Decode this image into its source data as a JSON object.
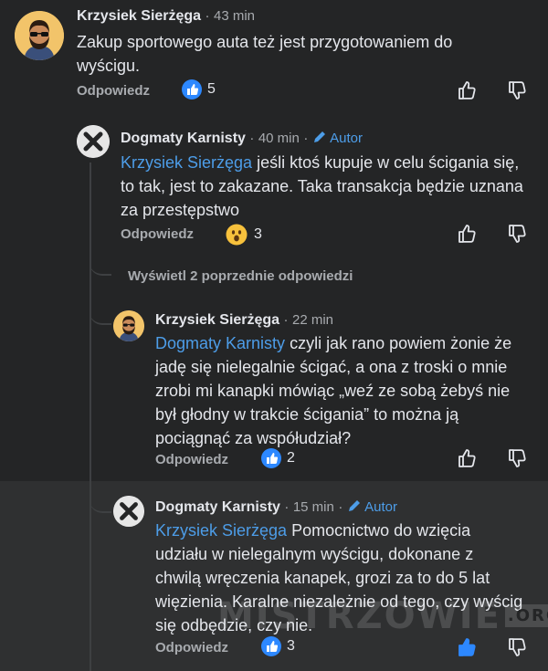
{
  "comments": [
    {
      "author": "Krzysiek Sierżęga",
      "time": "43 min",
      "lines": [
        "Zakup sportowego auta też jest przygotowaniem do",
        "wyścigu."
      ],
      "reply": "Odpowiedz",
      "reaction_count": "5"
    },
    {
      "author": "Dogmaty Karnisty",
      "time": "40 min",
      "badge": "Autor",
      "mention": "Krzysiek Sierżęga",
      "lines": [
        " jeśli ktoś kupuje w celu ścigania się,",
        "to tak, jest to zakazane. Taka transakcja będzie uznana",
        "za przestępstwo"
      ],
      "reply": "Odpowiedz",
      "reaction_count": "3"
    },
    {
      "author": "Krzysiek Sierżęga",
      "time": "22 min",
      "mention": "Dogmaty Karnisty",
      "lines": [
        " czyli jak rano powiem żonie że",
        "jadę się nielegalnie ścigać, a ona z troski o mnie",
        "zrobi mi kanapki mówiąc „weź ze sobą żebyś nie",
        "był głodny w trakcie ścigania” to można ją",
        "pociągnąć za współudział?"
      ],
      "reply": "Odpowiedz",
      "reaction_count": "2"
    },
    {
      "author": "Dogmaty Karnisty",
      "time": "15 min",
      "badge": "Autor",
      "mention": "Krzysiek Sierżęga",
      "lines": [
        " Pomocnictwo do wzięcia",
        "udziału w nielegalnym wyścigu, dokonane z",
        "chwilą wręczenia kanapek, grozi za to do 5 lat",
        "więzienia. Karalne niezależnie od tego, czy wyścig",
        "się odbędzie, czy nie."
      ],
      "reply": "Odpowiedz",
      "reaction_count": "3"
    }
  ],
  "view_previous": "Wyświetl 2 poprzednie odpowiedzi",
  "separator": "·",
  "watermark": "MISTRZOWIE",
  "watermark_tld": ".ORG",
  "icons": {
    "like": "thumbs-up-icon",
    "dislike": "thumbs-down-icon",
    "wow": "wow-emoji-icon",
    "pencil": "pencil-icon"
  },
  "colors": {
    "background": "#242526",
    "highlight_background": "#2f3031",
    "mention": "#4d9de8",
    "like_blue": "#2d88ff"
  }
}
